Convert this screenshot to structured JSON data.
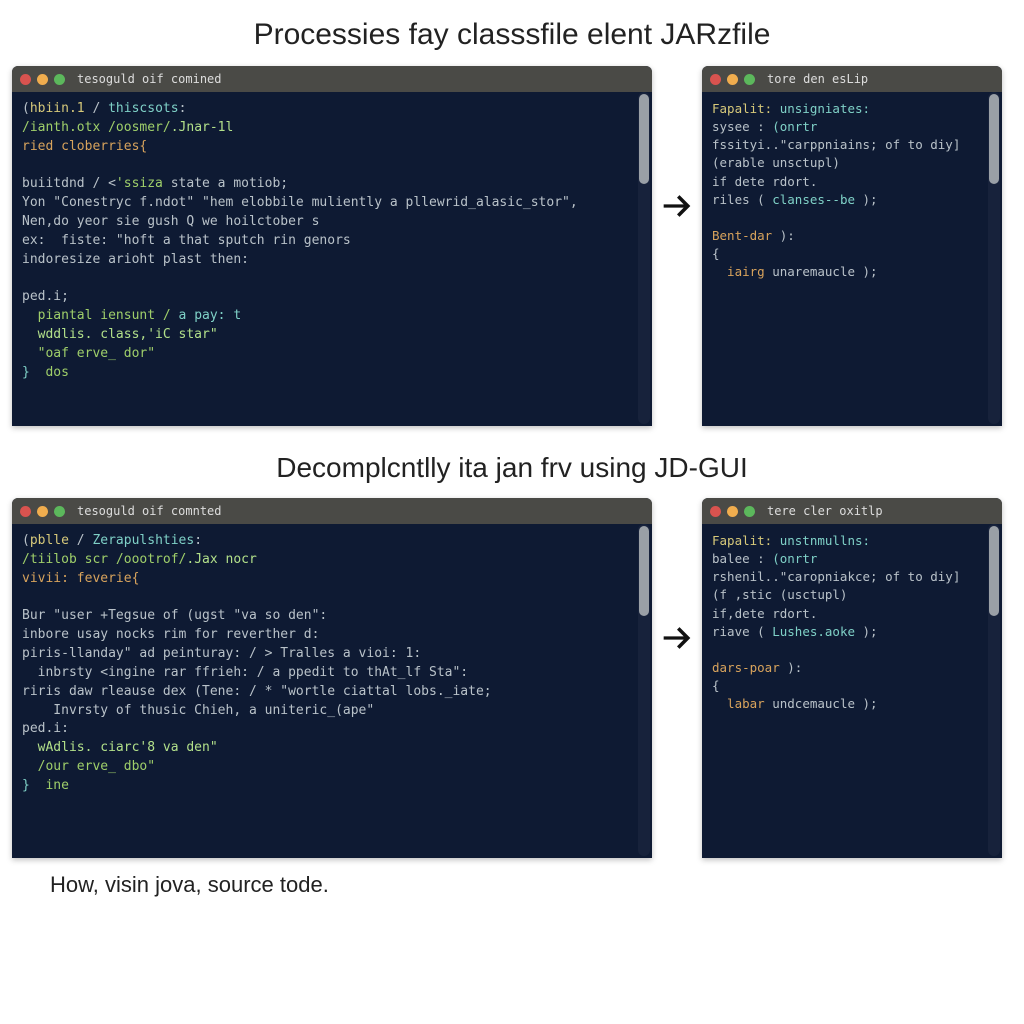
{
  "heading1": "Processies fay classsfile elent JARzfile",
  "heading2": "Decomplcntlly ita jan frv using JD-GUI",
  "caption": "How, visin jova, source tode.",
  "terminals": {
    "topLeft": {
      "title": "tesoguld oif comined",
      "lines": [
        {
          "segs": [
            {
              "t": "(",
              "c": "c-gray"
            },
            {
              "t": "hbiin.1 ",
              "c": "c-yellow"
            },
            {
              "t": "/ ",
              "c": "c-gray"
            },
            {
              "t": "thiscsots",
              "c": "c-cyan"
            },
            {
              "t": ":",
              "c": "c-gray"
            }
          ]
        },
        {
          "segs": [
            {
              "t": "/ianth.otx ",
              "c": "c-green"
            },
            {
              "t": "/oosmer/",
              "c": "c-green"
            },
            {
              "t": ".Jnar-1l",
              "c": "c-lgreen"
            }
          ]
        },
        {
          "segs": [
            {
              "t": "ried cloberries{",
              "c": "c-orange"
            }
          ]
        },
        {
          "segs": [
            {
              "t": "",
              "c": "c-gray"
            }
          ]
        },
        {
          "segs": [
            {
              "t": "buiitdnd / <",
              "c": "c-gray"
            },
            {
              "t": "'ssiza",
              "c": "c-green"
            },
            {
              "t": " state a motiob;",
              "c": "c-gray"
            }
          ]
        },
        {
          "segs": [
            {
              "t": "Yon \"Conestryc f.ndot\" \"hem elobbile muliently a pllewrid_alasic_stor\",",
              "c": "c-gray"
            }
          ]
        },
        {
          "segs": [
            {
              "t": "Nen,do yeor sie gush Q we hoilctober s",
              "c": "c-gray"
            }
          ]
        },
        {
          "segs": [
            {
              "t": "ex:  fiste: \"hoft a that sputch rin genors",
              "c": "c-gray"
            }
          ]
        },
        {
          "segs": [
            {
              "t": "indoresize arioht plast then:",
              "c": "c-gray"
            }
          ]
        },
        {
          "segs": [
            {
              "t": "",
              "c": "c-gray"
            }
          ]
        },
        {
          "segs": [
            {
              "t": "ped.i;",
              "c": "c-gray"
            }
          ]
        },
        {
          "segs": [
            {
              "t": "  piantal iensunt / ",
              "c": "c-green"
            },
            {
              "t": "a pay: t",
              "c": "c-cyan"
            }
          ]
        },
        {
          "segs": [
            {
              "t": "  wddlis. class,'iC star\"",
              "c": "c-lgreen"
            }
          ]
        },
        {
          "segs": [
            {
              "t": "  \"oaf erve_ dor\"",
              "c": "c-green"
            }
          ]
        },
        {
          "segs": [
            {
              "t": "}",
              "c": "c-cyan"
            },
            {
              "t": "  dos",
              "c": "c-green"
            }
          ]
        }
      ]
    },
    "topRight": {
      "title": "tore den esLip",
      "lines": [
        {
          "segs": [
            {
              "t": "Fapalit: ",
              "c": "c-yellow"
            },
            {
              "t": "unsigniates:",
              "c": "c-cyan"
            }
          ]
        },
        {
          "segs": [
            {
              "t": "sysee : ",
              "c": "c-gray"
            },
            {
              "t": "(onrtr",
              "c": "c-cyan"
            }
          ]
        },
        {
          "segs": [
            {
              "t": "fssityi..\"carppniains; of to diy]",
              "c": "c-gray"
            }
          ]
        },
        {
          "segs": [
            {
              "t": "(erable unsctupl)",
              "c": "c-gray"
            }
          ]
        },
        {
          "segs": [
            {
              "t": "if dete rdort.",
              "c": "c-gray"
            }
          ]
        },
        {
          "segs": [
            {
              "t": "riles ( ",
              "c": "c-gray"
            },
            {
              "t": "clanses--be ",
              "c": "c-cyan"
            },
            {
              "t": ");",
              "c": "c-gray"
            }
          ]
        },
        {
          "segs": [
            {
              "t": "",
              "c": "c-gray"
            }
          ]
        },
        {
          "segs": [
            {
              "t": "Bent-dar ",
              "c": "c-orange"
            },
            {
              "t": "):",
              "c": "c-gray"
            }
          ]
        },
        {
          "segs": [
            {
              "t": "{",
              "c": "c-gray"
            }
          ]
        },
        {
          "segs": [
            {
              "t": "  iairg ",
              "c": "c-orange"
            },
            {
              "t": "unaremaucle );",
              "c": "c-gray"
            }
          ]
        }
      ]
    },
    "botLeft": {
      "title": "tesoguld oif comnted",
      "lines": [
        {
          "segs": [
            {
              "t": "(",
              "c": "c-gray"
            },
            {
              "t": "pblle ",
              "c": "c-yellow"
            },
            {
              "t": "/ ",
              "c": "c-gray"
            },
            {
              "t": "Zerapulshties",
              "c": "c-cyan"
            },
            {
              "t": ":",
              "c": "c-gray"
            }
          ]
        },
        {
          "segs": [
            {
              "t": "/tiilob scr ",
              "c": "c-green"
            },
            {
              "t": "/oootrof/",
              "c": "c-green"
            },
            {
              "t": ".Jax nocr",
              "c": "c-lgreen"
            }
          ]
        },
        {
          "segs": [
            {
              "t": "vivii: feverie{",
              "c": "c-orange"
            }
          ]
        },
        {
          "segs": [
            {
              "t": "",
              "c": "c-gray"
            }
          ]
        },
        {
          "segs": [
            {
              "t": "Bur \"user +Tegsue of (ugst \"va so den\":",
              "c": "c-gray"
            }
          ]
        },
        {
          "segs": [
            {
              "t": "inbore usay nocks rim for reverther d:",
              "c": "c-gray"
            }
          ]
        },
        {
          "segs": [
            {
              "t": "piris-llanday\" ad peinturay: / > Tralles a vioi: 1:",
              "c": "c-gray"
            }
          ]
        },
        {
          "segs": [
            {
              "t": "  inbrsty <ingine rar ffrieh: / a ppedit to thAt_lf Sta\":",
              "c": "c-gray"
            }
          ]
        },
        {
          "segs": [
            {
              "t": "riris daw rleause dex (Tene: / * \"wortle ciattal lobs._iate;",
              "c": "c-gray"
            }
          ]
        },
        {
          "segs": [
            {
              "t": "    Invrsty of thusic Chieh, a uniteric_(ape\"",
              "c": "c-gray"
            }
          ]
        },
        {
          "segs": [
            {
              "t": "ped.i:",
              "c": "c-gray"
            }
          ]
        },
        {
          "segs": [
            {
              "t": "  wAdlis. ciarc'8 va den\"",
              "c": "c-lgreen"
            }
          ]
        },
        {
          "segs": [
            {
              "t": "  /our erve_ dbo\"",
              "c": "c-green"
            }
          ]
        },
        {
          "segs": [
            {
              "t": "}",
              "c": "c-cyan"
            },
            {
              "t": "  ine",
              "c": "c-green"
            }
          ]
        }
      ]
    },
    "botRight": {
      "title": "tere cler oxitlp",
      "lines": [
        {
          "segs": [
            {
              "t": "Fapalit: ",
              "c": "c-yellow"
            },
            {
              "t": "unstnmullns:",
              "c": "c-cyan"
            }
          ]
        },
        {
          "segs": [
            {
              "t": "balee : ",
              "c": "c-gray"
            },
            {
              "t": "(onrtr",
              "c": "c-cyan"
            }
          ]
        },
        {
          "segs": [
            {
              "t": "rshenil..\"caropniakce; of to diy]",
              "c": "c-gray"
            }
          ]
        },
        {
          "segs": [
            {
              "t": "(f ,stic (usctupl)",
              "c": "c-gray"
            }
          ]
        },
        {
          "segs": [
            {
              "t": "if,dete rdort.",
              "c": "c-gray"
            }
          ]
        },
        {
          "segs": [
            {
              "t": "riave ( ",
              "c": "c-gray"
            },
            {
              "t": "Lushes.aoke ",
              "c": "c-cyan"
            },
            {
              "t": ");",
              "c": "c-gray"
            }
          ]
        },
        {
          "segs": [
            {
              "t": "",
              "c": "c-gray"
            }
          ]
        },
        {
          "segs": [
            {
              "t": "dars-poar ",
              "c": "c-orange"
            },
            {
              "t": "):",
              "c": "c-gray"
            }
          ]
        },
        {
          "segs": [
            {
              "t": "{",
              "c": "c-gray"
            }
          ]
        },
        {
          "segs": [
            {
              "t": "  labar ",
              "c": "c-orange"
            },
            {
              "t": "undcemaucle );",
              "c": "c-gray"
            }
          ]
        }
      ]
    }
  }
}
